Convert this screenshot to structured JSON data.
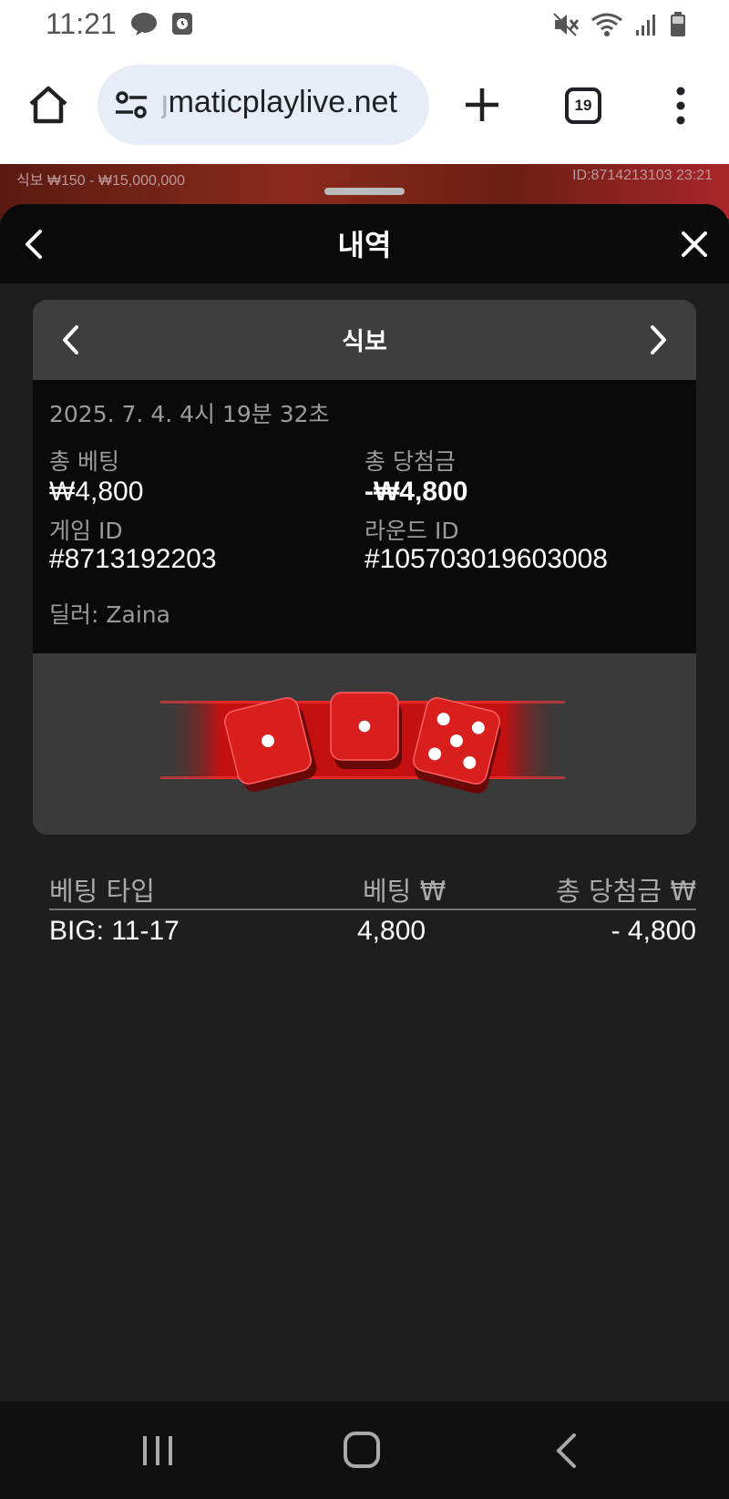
{
  "status_bar": {
    "time": "11:21",
    "left_icons": [
      "chat-bubble-icon",
      "clock-app-icon"
    ],
    "right_icons": [
      "mute-icon",
      "wifi-icon",
      "signal-icon",
      "battery-icon"
    ]
  },
  "browser": {
    "url_faded": "ȷ",
    "url": "maticplaylive.net",
    "tab_count": "19"
  },
  "game_strip": {
    "limits": "식보  ₩150 - ₩15,000,000",
    "id_time": "ID:8714213103  23:21"
  },
  "modal": {
    "title": "내역"
  },
  "card": {
    "title": "식보",
    "date": "2025. 7. 4. 4시 19분 32초",
    "total_bet_label": "총 베팅",
    "total_bet_value": "₩4,800",
    "total_win_label": "총 당첨금",
    "total_win_value": "-₩4,800",
    "game_id_label": "게임 ID",
    "game_id_value": "#8713192203",
    "round_id_label": "라운드 ID",
    "round_id_value": "#105703019603008",
    "dealer": "딜러: Zaina",
    "dice": [
      1,
      1,
      5
    ],
    "dice_color": "#d91e1e"
  },
  "bets": {
    "headers": [
      "베팅 타입",
      "베팅 ₩",
      "총 당첨금 ₩"
    ],
    "rows": [
      {
        "type": "BIG: 11-17",
        "bet": "4,800",
        "win": "- 4,800"
      }
    ]
  },
  "nav": {
    "icons": [
      "recent-apps-icon",
      "home-icon",
      "back-icon"
    ]
  }
}
